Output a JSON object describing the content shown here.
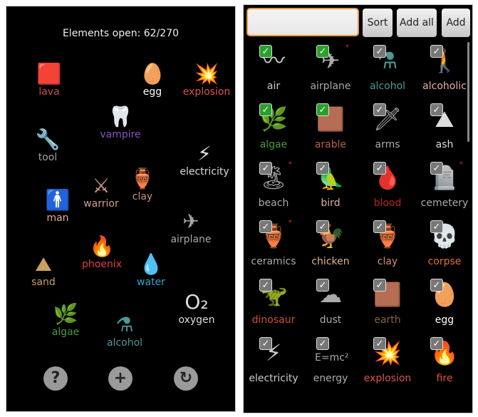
{
  "left": {
    "title": "Elements open: 62/270",
    "elements": [
      {
        "label": "lava",
        "icon": "🟥",
        "color": "#c8504a"
      },
      {
        "label": "egg",
        "icon": "🥚",
        "color": "#ffffff"
      },
      {
        "label": "explosion",
        "icon": "💥",
        "color": "#d9534f"
      },
      {
        "label": "vampire",
        "icon": "🦷",
        "color": "#8a4fc0"
      },
      {
        "label": "tool",
        "icon": "🔧",
        "color": "#a0a0a0"
      },
      {
        "label": "electricity",
        "icon": "⚡",
        "color": "#dddddd"
      },
      {
        "label": "warrior",
        "icon": "⚔",
        "color": "#d4a08a"
      },
      {
        "label": "clay",
        "icon": "🏺",
        "color": "#c8907a"
      },
      {
        "label": "man",
        "icon": "🚹",
        "color": "#e0b090"
      },
      {
        "label": "airplane",
        "icon": "✈",
        "color": "#a8a8a8"
      },
      {
        "label": "phoenix",
        "icon": "🔥",
        "color": "#e04040"
      },
      {
        "label": "sand",
        "icon": "⛰",
        "color": "#c8a060"
      },
      {
        "label": "water",
        "icon": "💧",
        "color": "#3aa0d0"
      },
      {
        "label": "oxygen",
        "icon": "O₂",
        "color": "#dddddd"
      },
      {
        "label": "algae",
        "icon": "🌿",
        "color": "#4a9a3a"
      },
      {
        "label": "alcohol",
        "icon": "⚗",
        "color": "#4a9a9a"
      }
    ],
    "buttons": [
      {
        "name": "help",
        "icon": "?"
      },
      {
        "name": "add",
        "icon": "+"
      },
      {
        "name": "reset",
        "icon": "↻"
      }
    ]
  },
  "right": {
    "search": {
      "value": "",
      "placeholder": ""
    },
    "sort_label": "Sort",
    "add_all_label": "Add all",
    "add_label": "Add",
    "items": [
      {
        "label": "air",
        "icon": "〰",
        "color": "#cccccc",
        "checked": true,
        "new": false
      },
      {
        "label": "airplane",
        "icon": "✈",
        "color": "#aaaaaa",
        "checked": true,
        "new": true
      },
      {
        "label": "alcohol",
        "icon": "⚗",
        "color": "#4a9a9a",
        "checked": false,
        "new": false
      },
      {
        "label": "alcoholic",
        "icon": "🚶",
        "color": "#e8b0a0",
        "checked": false,
        "new": false
      },
      {
        "label": "algae",
        "icon": "🌿",
        "color": "#4a9a3a",
        "checked": true,
        "new": false
      },
      {
        "label": "arable",
        "icon": "🟫",
        "color": "#b06050",
        "checked": true,
        "new": false
      },
      {
        "label": "arms",
        "icon": "🗡",
        "color": "#aaaaaa",
        "checked": false,
        "new": false
      },
      {
        "label": "ash",
        "icon": "⛰",
        "color": "#dddddd",
        "checked": false,
        "new": false
      },
      {
        "label": "beach",
        "icon": "🏝",
        "color": "#aaaaaa",
        "checked": false,
        "new": true
      },
      {
        "label": "bird",
        "icon": "🦜",
        "color": "#e0b0a0",
        "checked": false,
        "new": false
      },
      {
        "label": "blood",
        "icon": "🩸",
        "color": "#c02020",
        "checked": false,
        "new": false
      },
      {
        "label": "cemetery",
        "icon": "🪦",
        "color": "#aaaaaa",
        "checked": false,
        "new": true
      },
      {
        "label": "ceramics",
        "icon": "🏺",
        "color": "#aaaaaa",
        "checked": false,
        "new": true
      },
      {
        "label": "chicken",
        "icon": "🐓",
        "color": "#e0b090",
        "checked": false,
        "new": false
      },
      {
        "label": "clay",
        "icon": "🏺",
        "color": "#c8907a",
        "checked": false,
        "new": false
      },
      {
        "label": "corpse",
        "icon": "💀",
        "color": "#e07030",
        "checked": false,
        "new": false
      },
      {
        "label": "dinosaur",
        "icon": "🦖",
        "color": "#d05030",
        "checked": false,
        "new": false
      },
      {
        "label": "dust",
        "icon": "☁",
        "color": "#aaaaaa",
        "checked": false,
        "new": false
      },
      {
        "label": "earth",
        "icon": "🟫",
        "color": "#8a6040",
        "checked": false,
        "new": false
      },
      {
        "label": "egg",
        "icon": "🥚",
        "color": "#ffffff",
        "checked": false,
        "new": false
      },
      {
        "label": "electricity",
        "icon": "⚡",
        "color": "#cccccc",
        "checked": false,
        "new": false
      },
      {
        "label": "energy",
        "icon": "E=mc²",
        "color": "#aaaaaa",
        "checked": false,
        "new": false
      },
      {
        "label": "explosion",
        "icon": "💥",
        "color": "#d9534f",
        "checked": false,
        "new": false
      },
      {
        "label": "fire",
        "icon": "🔥",
        "color": "#e05030",
        "checked": false,
        "new": false
      }
    ]
  }
}
